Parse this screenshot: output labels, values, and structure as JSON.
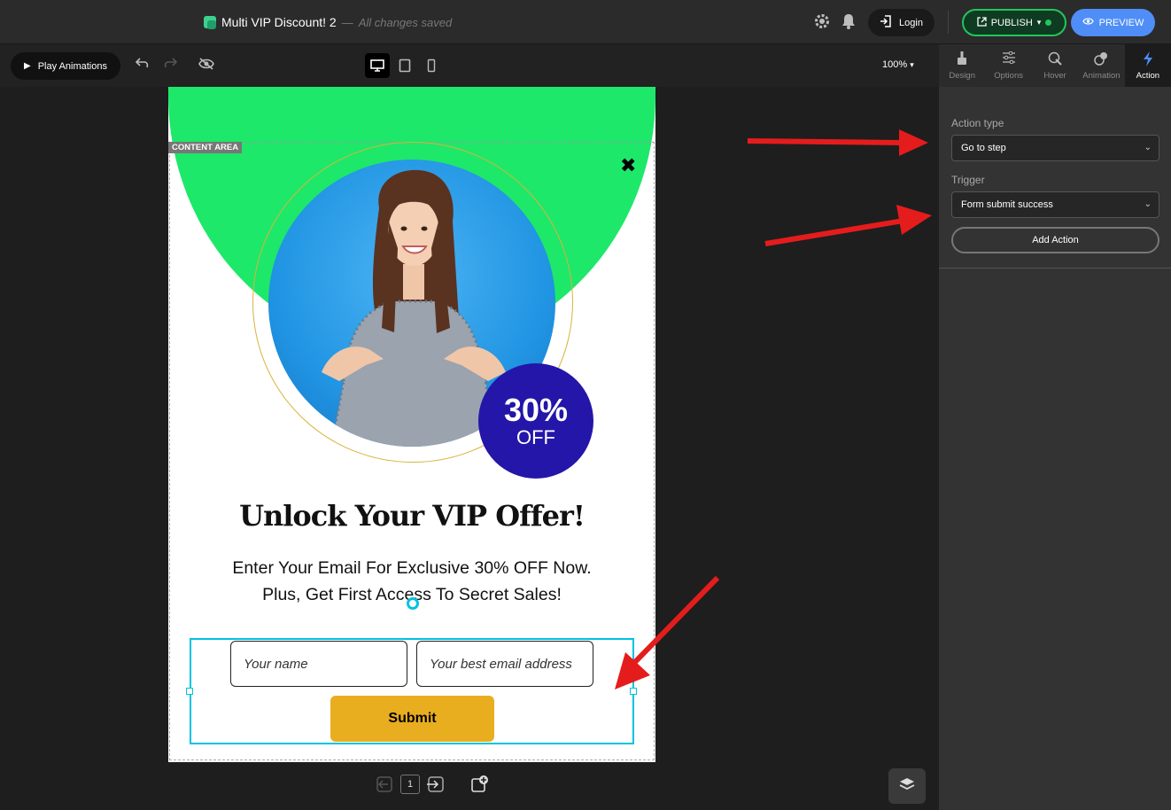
{
  "header": {
    "doc_title": "Multi VIP Discount! 2",
    "separator": "—",
    "save_status": "All changes saved",
    "login_label": "Login",
    "publish_label": "PUBLISH",
    "preview_label": "PREVIEW"
  },
  "toolbar": {
    "play_label": "Play Animations",
    "zoom_value": "100%"
  },
  "panel": {
    "tabs": [
      {
        "label": "Design",
        "icon": "brush-icon"
      },
      {
        "label": "Options",
        "icon": "sliders-icon"
      },
      {
        "label": "Hover",
        "icon": "cursor-icon"
      },
      {
        "label": "Animation",
        "icon": "animation-icon"
      },
      {
        "label": "Action",
        "icon": "lightning-icon"
      }
    ],
    "active_tab": "Action",
    "action_type_label": "Action type",
    "action_type_value": "Go to step",
    "trigger_label": "Trigger",
    "trigger_value": "Form submit success",
    "add_action_label": "Add Action"
  },
  "popup": {
    "content_area_tag": "CONTENT AREA",
    "badge_percent": "30%",
    "badge_off": "OFF",
    "headline": "Unlock Your VIP Offer!",
    "subtext_line1": "Enter Your Email For Exclusive 30% OFF Now.",
    "subtext_line2": "Plus, Get First Access To Secret Sales!",
    "name_placeholder": "Your name",
    "email_placeholder": "Your best email address",
    "submit_label": "Submit"
  },
  "bottom_nav": {
    "step_number": "1"
  },
  "colors": {
    "green": "#1de86a",
    "badge": "#2316a8",
    "submit": "#e9ae1f",
    "selection": "#00c3e0",
    "publish": "#22c55e",
    "preview": "#4f8ef7",
    "arrow": "#e51c1c"
  }
}
